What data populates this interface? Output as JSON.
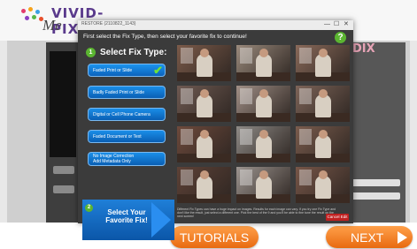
{
  "app": {
    "logo_word": "VIVID-PIX",
    "logo_sub": "Me",
    "right_logo_fragment": "DIX",
    "tutorials_label": "TUTORIALS",
    "next_label": "NEXT"
  },
  "dialog": {
    "window_title": "RESTORE (2110822_1143)",
    "window_controls": [
      "—",
      "☐",
      "✕"
    ],
    "instruction": "First select the Fix Type, then select your favorite fix to continue!",
    "help_label": "?",
    "step1": {
      "number": "1",
      "label": "Select Fix Type:"
    },
    "fix_types": [
      {
        "label": "Faded Print or Slide",
        "selected": true
      },
      {
        "label": "Badly Faded Print or Slide",
        "selected": false
      },
      {
        "label": "Digital or Cell Phone Camera",
        "selected": false
      },
      {
        "label": "Faded Document or Text",
        "selected": false
      },
      {
        "label": "No Image Correction\nAdd Metadata Only",
        "selected": false
      }
    ],
    "step2": {
      "number": "2",
      "label": "Select Your Favorite Fix!"
    },
    "footnote": "Different Fix Types can have a huge impact on images. Results for each image can vary. If you try one Fix Type and don't like the result, just select a different one. Pick the best of the 9 and you'll be able to fine tune the result on the next screen!",
    "cancel_label": "Cancel Edit",
    "photo_tones": [
      "#7c5b4a",
      "#9a8a7c",
      "#8a6a5a",
      "#6f5a52",
      "#a08f86",
      "#7d6458",
      "#6e4a3c",
      "#8e8a86",
      "#7a5c4d",
      "#5e4237",
      "#9c948f",
      "#775648"
    ],
    "check_glyph": "✔"
  },
  "colors": {
    "accent_green": "#5bb531",
    "button_blue": "#0a5fb4",
    "orange": "#e86a10"
  }
}
